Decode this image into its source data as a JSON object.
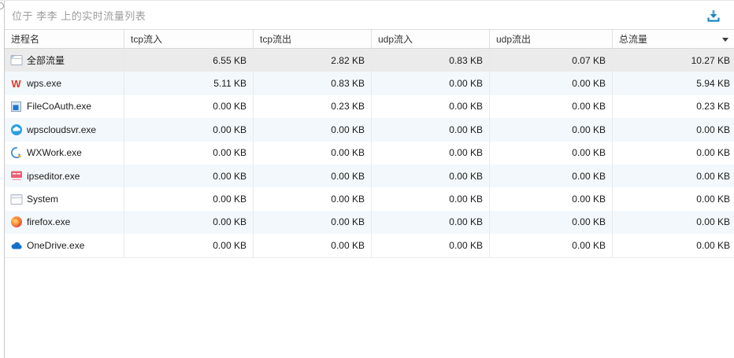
{
  "panel": {
    "title": "位于 李李 上的实时流量列表"
  },
  "icons": {
    "download": "download-icon",
    "column_dropdown": "chevron-down-icon"
  },
  "colors": {
    "accent_blue": "#1787c0",
    "selected_row": "#ebebeb",
    "alt_row": "#f3f8fc",
    "title_gray": "#9c9c9c"
  },
  "table": {
    "columns": [
      "进程名",
      "tcp流入",
      "tcp流出",
      "udp流入",
      "udp流出",
      "总流量"
    ],
    "unit": "KB",
    "rows": [
      {
        "name": "全部流量",
        "tcp_in": "6.55 KB",
        "tcp_out": "2.82 KB",
        "udp_in": "0.83 KB",
        "udp_out": "0.07 KB",
        "total": "10.27 KB"
      },
      {
        "name": "wps.exe",
        "tcp_in": "5.11 KB",
        "tcp_out": "0.83 KB",
        "udp_in": "0.00 KB",
        "udp_out": "0.00 KB",
        "total": "5.94 KB"
      },
      {
        "name": "FileCoAuth.exe",
        "tcp_in": "0.00 KB",
        "tcp_out": "0.23 KB",
        "udp_in": "0.00 KB",
        "udp_out": "0.00 KB",
        "total": "0.23 KB"
      },
      {
        "name": "wpscloudsvr.exe",
        "tcp_in": "0.00 KB",
        "tcp_out": "0.00 KB",
        "udp_in": "0.00 KB",
        "udp_out": "0.00 KB",
        "total": "0.00 KB"
      },
      {
        "name": "WXWork.exe",
        "tcp_in": "0.00 KB",
        "tcp_out": "0.00 KB",
        "udp_in": "0.00 KB",
        "udp_out": "0.00 KB",
        "total": "0.00 KB"
      },
      {
        "name": "ipseditor.exe",
        "tcp_in": "0.00 KB",
        "tcp_out": "0.00 KB",
        "udp_in": "0.00 KB",
        "udp_out": "0.00 KB",
        "total": "0.00 KB"
      },
      {
        "name": "System",
        "tcp_in": "0.00 KB",
        "tcp_out": "0.00 KB",
        "udp_in": "0.00 KB",
        "udp_out": "0.00 KB",
        "total": "0.00 KB"
      },
      {
        "name": "firefox.exe",
        "tcp_in": "0.00 KB",
        "tcp_out": "0.00 KB",
        "udp_in": "0.00 KB",
        "udp_out": "0.00 KB",
        "total": "0.00 KB"
      },
      {
        "name": "OneDrive.exe",
        "tcp_in": "0.00 KB",
        "tcp_out": "0.00 KB",
        "udp_in": "0.00 KB",
        "udp_out": "0.00 KB",
        "total": "0.00 KB"
      }
    ]
  }
}
